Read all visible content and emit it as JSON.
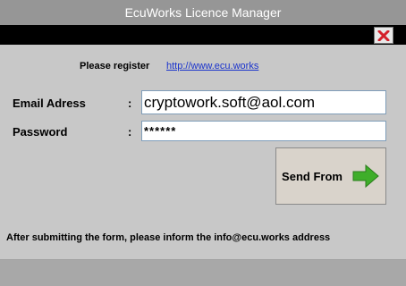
{
  "window": {
    "title": "EcuWorks Licence Manager"
  },
  "register": {
    "label": "Please register",
    "link": "http://www.ecu.works"
  },
  "form": {
    "email_label": "Email Adress",
    "email_colon": ":",
    "email_value": "cryptowork.soft@aol.com",
    "password_label": "Password",
    "password_colon": ":",
    "password_value": "******"
  },
  "send_button": {
    "label": "Send From",
    "icon": "right-arrow-icon"
  },
  "footer": {
    "note": "After submitting the form, please inform the info@ecu.works address"
  },
  "colors": {
    "accent_green": "#3fae2a",
    "close_red": "#d4202a",
    "link_blue": "#1a33cc"
  }
}
